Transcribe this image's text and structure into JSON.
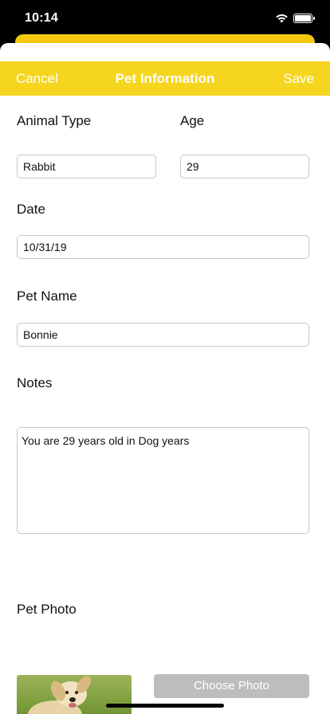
{
  "status_bar": {
    "time": "10:14"
  },
  "nav": {
    "cancel": "Cancel",
    "title": "Pet Information",
    "save": "Save"
  },
  "form": {
    "animal_type_label": "Animal Type",
    "age_label": "Age",
    "animal_type_value": "Rabbit",
    "age_value": "29",
    "date_label": "Date",
    "date_value": "10/31/19",
    "pet_name_label": "Pet Name",
    "pet_name_value": "Bonnie",
    "notes_label": "Notes",
    "notes_value": "You are 29 years old in Dog years",
    "pet_photo_label": "Pet Photo",
    "choose_photo": "Choose Photo"
  },
  "colors": {
    "nav_yellow": "#f5d51e",
    "button_gray": "#bdbdbd"
  }
}
